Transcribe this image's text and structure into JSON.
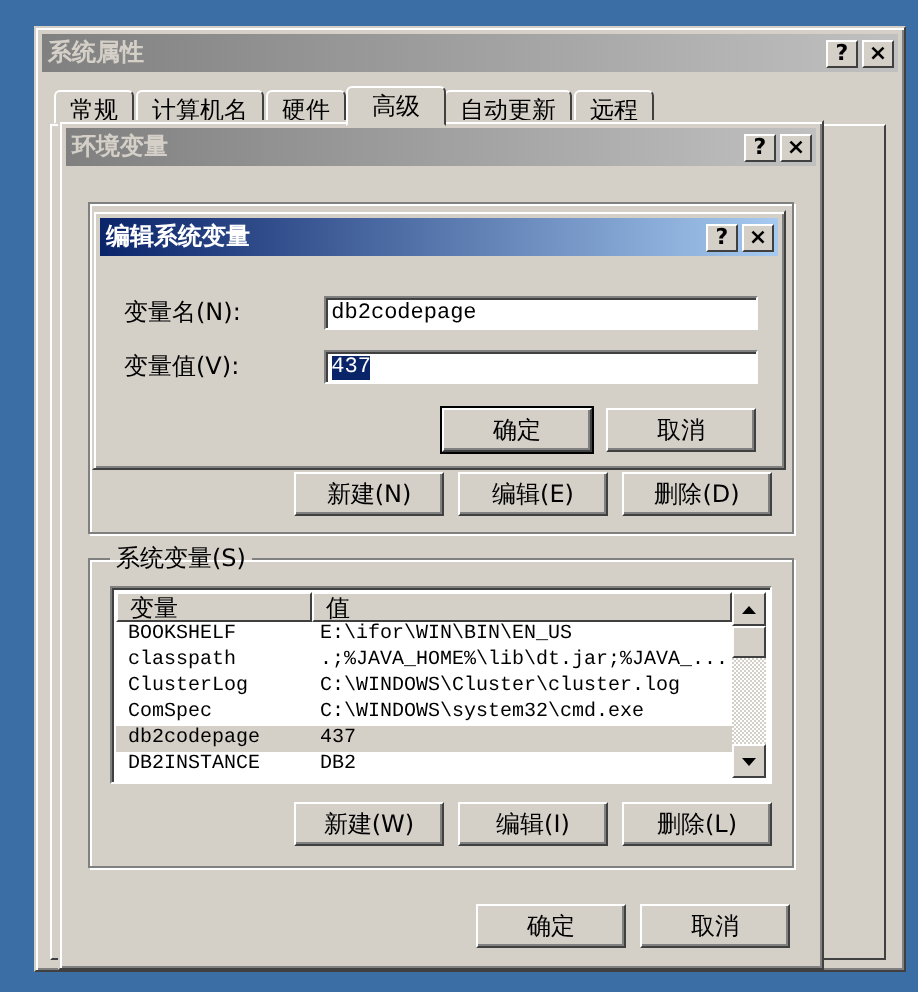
{
  "system_properties": {
    "title": "系统属性",
    "title_buttons": [
      "?",
      "×"
    ],
    "tabs": [
      {
        "label": "常规",
        "selected": false
      },
      {
        "label": "计算机名",
        "selected": false
      },
      {
        "label": "硬件",
        "selected": false
      },
      {
        "label": "高级",
        "selected": true
      },
      {
        "label": "自动更新",
        "selected": false
      },
      {
        "label": "远程",
        "selected": false
      }
    ]
  },
  "environment_variables": {
    "title": "环境变量",
    "title_buttons": [
      "?",
      "×"
    ],
    "user_variable_buttons": [
      "新建(N)",
      "编辑(E)",
      "删除(D)"
    ],
    "system_variables": {
      "label": "系统变量(S)",
      "columns": [
        "变量",
        "值"
      ],
      "rows": [
        {
          "name": "BOOKSHELF",
          "value": "E:\\ifor\\WIN\\BIN\\EN_US",
          "selected": false
        },
        {
          "name": "classpath",
          "value": ".;%JAVA_HOME%\\lib\\dt.jar;%JAVA_...",
          "selected": false
        },
        {
          "name": "ClusterLog",
          "value": "C:\\WINDOWS\\Cluster\\cluster.log",
          "selected": false
        },
        {
          "name": "ComSpec",
          "value": "C:\\WINDOWS\\system32\\cmd.exe",
          "selected": false
        },
        {
          "name": "db2codepage",
          "value": "437",
          "selected": true
        },
        {
          "name": "DB2INSTANCE",
          "value": "DB2",
          "selected": false
        }
      ],
      "buttons": [
        "新建(W)",
        "编辑(I)",
        "删除(L)"
      ]
    },
    "footer_buttons": [
      "确定",
      "取消"
    ]
  },
  "edit_dialog": {
    "title": "编辑系统变量",
    "title_buttons": [
      "?",
      "×"
    ],
    "fields": [
      {
        "label": "变量名(N):",
        "value": "db2codepage",
        "selected": false
      },
      {
        "label": "变量值(V):",
        "value": "437",
        "selected": true
      }
    ],
    "buttons": [
      {
        "label": "确定",
        "default": true
      },
      {
        "label": "取消",
        "default": false
      }
    ]
  }
}
